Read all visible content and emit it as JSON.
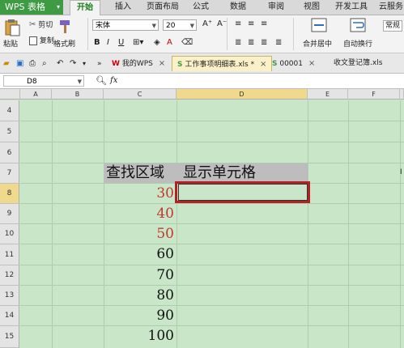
{
  "menubar": {
    "brand": "WPS 表格",
    "items": [
      "开始",
      "插入",
      "页面布局",
      "公式",
      "数据",
      "审阅",
      "视图",
      "开发工具",
      "云服务"
    ]
  },
  "ribbon": {
    "paste": "粘贴",
    "cut": "剪切",
    "copy": "复制",
    "format_painter": "格式刷",
    "font_name": "宋体",
    "font_size": "20",
    "merge_center": "合并居中",
    "wrap_text": "自动换行",
    "general": "常规"
  },
  "tabs": [
    {
      "label": "我的WPS"
    },
    {
      "label": "工作事项明细表.xls *"
    },
    {
      "label": "00001"
    },
    {
      "label": "收文登记簿.xls"
    }
  ],
  "formula_bar": {
    "name_box": "D8",
    "fx": "fx"
  },
  "columns": [
    "A",
    "B",
    "C",
    "D",
    "E",
    "F"
  ],
  "rows": [
    "4",
    "5",
    "6",
    "7",
    "8",
    "9",
    "10",
    "11",
    "12",
    "13",
    "14",
    "15"
  ],
  "sheet": {
    "header_c": "查找区域",
    "header_d": "显示单元格",
    "values": [
      {
        "v": "30",
        "color": "#c0392b"
      },
      {
        "v": "40",
        "color": "#c0392b"
      },
      {
        "v": "50",
        "color": "#c0392b"
      },
      {
        "v": "60",
        "color": "#111111"
      },
      {
        "v": "70",
        "color": "#111111"
      },
      {
        "v": "80",
        "color": "#111111"
      },
      {
        "v": "90",
        "color": "#111111"
      },
      {
        "v": "100",
        "color": "#111111"
      }
    ]
  },
  "colors": {
    "accent": "#3e9b43",
    "grid_bg": "#c9e6c9",
    "selection_border": "#b22222"
  }
}
